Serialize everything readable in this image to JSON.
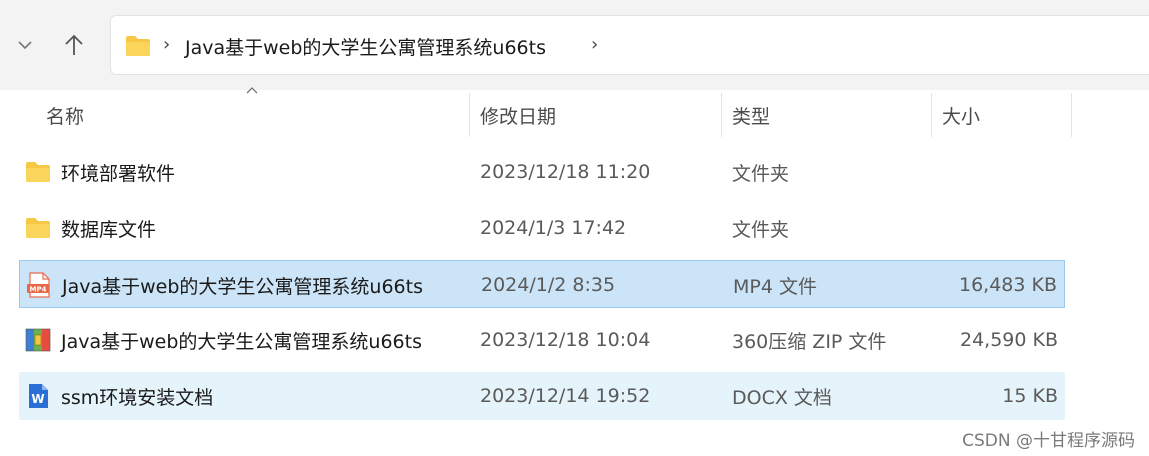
{
  "breadcrumb": {
    "path_label": "Java基于web的大学生公寓管理系统u66ts",
    "separator": "›"
  },
  "columns": {
    "name": "名称",
    "date": "修改日期",
    "type": "类型",
    "size": "大小"
  },
  "files": [
    {
      "name": "环境部署软件",
      "date": "2023/12/18 11:20",
      "type": "文件夹",
      "size": "",
      "icon": "folder-icon"
    },
    {
      "name": "数据库文件",
      "date": "2024/1/3 17:42",
      "type": "文件夹",
      "size": "",
      "icon": "folder-icon"
    },
    {
      "name": "Java基于web的大学生公寓管理系统u66ts",
      "date": "2024/1/2 8:35",
      "type": "MP4 文件",
      "size": "16,483 KB",
      "icon": "mp4-file-icon",
      "state": "selected"
    },
    {
      "name": "Java基于web的大学生公寓管理系统u66ts",
      "date": "2023/12/18 10:04",
      "type": "360压缩 ZIP 文件",
      "size": "24,590 KB",
      "icon": "zip-archive-icon"
    },
    {
      "name": "ssm环境安装文档",
      "date": "2023/12/14 19:52",
      "type": "DOCX 文档",
      "size": "15 KB",
      "icon": "word-doc-icon",
      "state": "hover"
    }
  ],
  "watermark": "CSDN @十甘程序源码",
  "colors": {
    "folder": "#f8c745",
    "selected_bg": "#cce4f7",
    "hover_bg": "#e5f3fb",
    "mp4_icon": "#e8694a",
    "word_icon": "#2b6fd6"
  }
}
